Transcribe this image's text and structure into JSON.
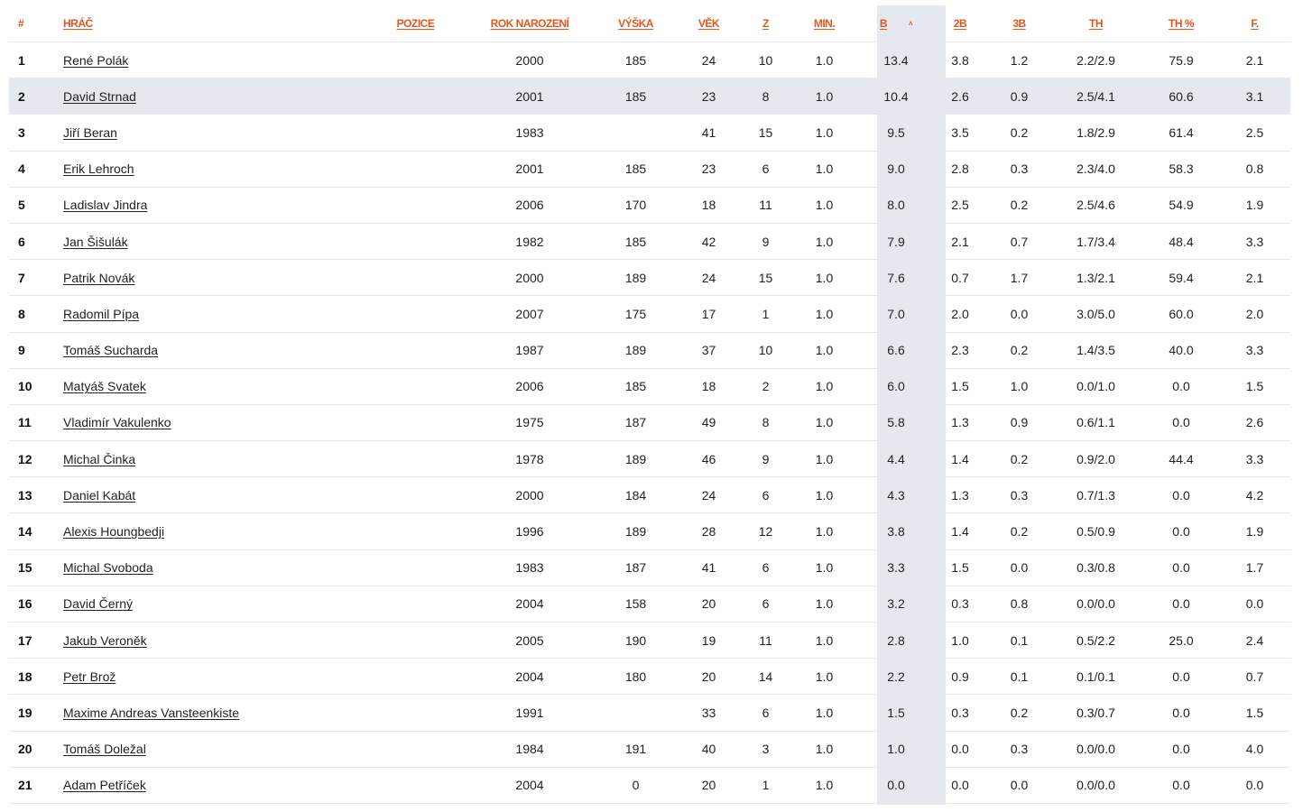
{
  "columns": [
    "#",
    "HRÁČ",
    "POZICE",
    "ROK NAROZENÍ",
    "VÝŠKA",
    "VĚK",
    "Z",
    "MIN.",
    "B",
    "2B",
    "3B",
    "TH",
    "TH %",
    "F."
  ],
  "sorted_column": "B",
  "sort_indicator": "˄",
  "rows": [
    {
      "rank": "1",
      "player": "René Polák",
      "pos": "",
      "born": "2000",
      "height": "185",
      "age": "24",
      "z": "10",
      "min": "1.0",
      "b": "13.4",
      "b2": "3.8",
      "b3": "1.2",
      "th": "2.2/2.9",
      "thp": "75.9",
      "f": "2.1"
    },
    {
      "rank": "2",
      "player": "David Strnad",
      "pos": "",
      "born": "2001",
      "height": "185",
      "age": "23",
      "z": "8",
      "min": "1.0",
      "b": "10.4",
      "b2": "2.6",
      "b3": "0.9",
      "th": "2.5/4.1",
      "thp": "60.6",
      "f": "3.1"
    },
    {
      "rank": "3",
      "player": "Jiří Beran",
      "pos": "",
      "born": "1983",
      "height": "",
      "age": "41",
      "z": "15",
      "min": "1.0",
      "b": "9.5",
      "b2": "3.5",
      "b3": "0.2",
      "th": "1.8/2.9",
      "thp": "61.4",
      "f": "2.5"
    },
    {
      "rank": "4",
      "player": "Erik Lehroch",
      "pos": "",
      "born": "2001",
      "height": "185",
      "age": "23",
      "z": "6",
      "min": "1.0",
      "b": "9.0",
      "b2": "2.8",
      "b3": "0.3",
      "th": "2.3/4.0",
      "thp": "58.3",
      "f": "0.8"
    },
    {
      "rank": "5",
      "player": "Ladislav Jindra",
      "pos": "",
      "born": "2006",
      "height": "170",
      "age": "18",
      "z": "11",
      "min": "1.0",
      "b": "8.0",
      "b2": "2.5",
      "b3": "0.2",
      "th": "2.5/4.6",
      "thp": "54.9",
      "f": "1.9"
    },
    {
      "rank": "6",
      "player": "Jan Šišulák",
      "pos": "",
      "born": "1982",
      "height": "185",
      "age": "42",
      "z": "9",
      "min": "1.0",
      "b": "7.9",
      "b2": "2.1",
      "b3": "0.7",
      "th": "1.7/3.4",
      "thp": "48.4",
      "f": "3.3"
    },
    {
      "rank": "7",
      "player": "Patrik Novák",
      "pos": "",
      "born": "2000",
      "height": "189",
      "age": "24",
      "z": "15",
      "min": "1.0",
      "b": "7.6",
      "b2": "0.7",
      "b3": "1.7",
      "th": "1.3/2.1",
      "thp": "59.4",
      "f": "2.1"
    },
    {
      "rank": "8",
      "player": "Radomil Pípa",
      "pos": "",
      "born": "2007",
      "height": "175",
      "age": "17",
      "z": "1",
      "min": "1.0",
      "b": "7.0",
      "b2": "2.0",
      "b3": "0.0",
      "th": "3.0/5.0",
      "thp": "60.0",
      "f": "2.0"
    },
    {
      "rank": "9",
      "player": "Tomáš Sucharda",
      "pos": "",
      "born": "1987",
      "height": "189",
      "age": "37",
      "z": "10",
      "min": "1.0",
      "b": "6.6",
      "b2": "2.3",
      "b3": "0.2",
      "th": "1.4/3.5",
      "thp": "40.0",
      "f": "3.3"
    },
    {
      "rank": "10",
      "player": "Matyáš Svatek",
      "pos": "",
      "born": "2006",
      "height": "185",
      "age": "18",
      "z": "2",
      "min": "1.0",
      "b": "6.0",
      "b2": "1.5",
      "b3": "1.0",
      "th": "0.0/1.0",
      "thp": "0.0",
      "f": "1.5"
    },
    {
      "rank": "11",
      "player": "Vladimír Vakulenko",
      "pos": "",
      "born": "1975",
      "height": "187",
      "age": "49",
      "z": "8",
      "min": "1.0",
      "b": "5.8",
      "b2": "1.3",
      "b3": "0.9",
      "th": "0.6/1.1",
      "thp": "0.0",
      "f": "2.6"
    },
    {
      "rank": "12",
      "player": "Michal Činka",
      "pos": "",
      "born": "1978",
      "height": "189",
      "age": "46",
      "z": "9",
      "min": "1.0",
      "b": "4.4",
      "b2": "1.4",
      "b3": "0.2",
      "th": "0.9/2.0",
      "thp": "44.4",
      "f": "3.3"
    },
    {
      "rank": "13",
      "player": "Daniel Kabát",
      "pos": "",
      "born": "2000",
      "height": "184",
      "age": "24",
      "z": "6",
      "min": "1.0",
      "b": "4.3",
      "b2": "1.3",
      "b3": "0.3",
      "th": "0.7/1.3",
      "thp": "0.0",
      "f": "4.2"
    },
    {
      "rank": "14",
      "player": "Alexis Houngbedji",
      "pos": "",
      "born": "1996",
      "height": "189",
      "age": "28",
      "z": "12",
      "min": "1.0",
      "b": "3.8",
      "b2": "1.4",
      "b3": "0.2",
      "th": "0.5/0.9",
      "thp": "0.0",
      "f": "1.9"
    },
    {
      "rank": "15",
      "player": "Michal Svoboda",
      "pos": "",
      "born": "1983",
      "height": "187",
      "age": "41",
      "z": "6",
      "min": "1.0",
      "b": "3.3",
      "b2": "1.5",
      "b3": "0.0",
      "th": "0.3/0.8",
      "thp": "0.0",
      "f": "1.7"
    },
    {
      "rank": "16",
      "player": "David Černý",
      "pos": "",
      "born": "2004",
      "height": "158",
      "age": "20",
      "z": "6",
      "min": "1.0",
      "b": "3.2",
      "b2": "0.3",
      "b3": "0.8",
      "th": "0.0/0.0",
      "thp": "0.0",
      "f": "0.0"
    },
    {
      "rank": "17",
      "player": "Jakub Veroněk",
      "pos": "",
      "born": "2005",
      "height": "190",
      "age": "19",
      "z": "11",
      "min": "1.0",
      "b": "2.8",
      "b2": "1.0",
      "b3": "0.1",
      "th": "0.5/2.2",
      "thp": "25.0",
      "f": "2.4"
    },
    {
      "rank": "18",
      "player": "Petr Brož",
      "pos": "",
      "born": "2004",
      "height": "180",
      "age": "20",
      "z": "14",
      "min": "1.0",
      "b": "2.2",
      "b2": "0.9",
      "b3": "0.1",
      "th": "0.1/0.1",
      "thp": "0.0",
      "f": "0.7"
    },
    {
      "rank": "19",
      "player": "Maxime Andreas Vansteenkiste",
      "pos": "",
      "born": "1991",
      "height": "",
      "age": "33",
      "z": "6",
      "min": "1.0",
      "b": "1.5",
      "b2": "0.3",
      "b3": "0.2",
      "th": "0.3/0.7",
      "thp": "0.0",
      "f": "1.5"
    },
    {
      "rank": "20",
      "player": "Tomáš Doležal",
      "pos": "",
      "born": "1984",
      "height": "191",
      "age": "40",
      "z": "3",
      "min": "1.0",
      "b": "1.0",
      "b2": "0.0",
      "b3": "0.3",
      "th": "0.0/0.0",
      "thp": "0.0",
      "f": "4.0"
    },
    {
      "rank": "21",
      "player": "Adam Petříček",
      "pos": "",
      "born": "2004",
      "height": "0",
      "age": "20",
      "z": "1",
      "min": "1.0",
      "b": "0.0",
      "b2": "0.0",
      "b3": "0.0",
      "th": "0.0/0.0",
      "thp": "0.0",
      "f": "0.0"
    }
  ],
  "highlighted_row": 1,
  "colors": {
    "accent": "#e2571b",
    "sorted_column_bg": "#e6e8ef",
    "row_border": "#e6e8ef",
    "text": "#222222"
  }
}
